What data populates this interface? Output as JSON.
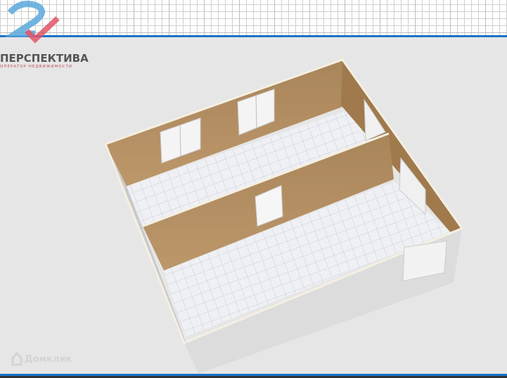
{
  "logo": {
    "title": "ПЕРСПЕКТИВА",
    "subtitle": "ОПЕРАТОР НЕДВИЖИМОСТИ"
  },
  "watermark": {
    "text": "Домклик"
  },
  "colors": {
    "accent": "#1a73c9",
    "wall": "#b08c5c",
    "floor": "#e4e8ee",
    "logo_blue": "#5aa8dc",
    "logo_red": "#e05565"
  }
}
